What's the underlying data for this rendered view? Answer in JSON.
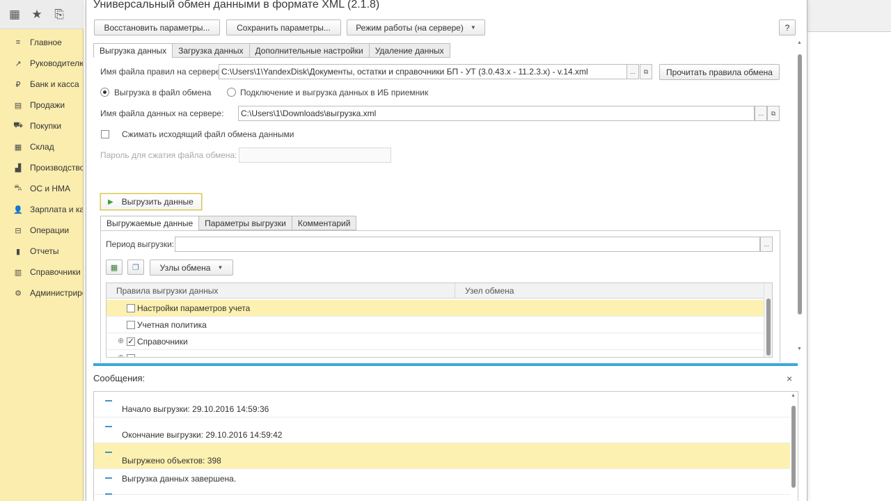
{
  "dialog": {
    "title": "Универсальный обмен данными в формате XML (2.1.8)",
    "help": "?"
  },
  "toolbar": {
    "restore": "Восстановить параметры...",
    "save": "Сохранить параметры...",
    "mode": "Режим работы (на сервере)"
  },
  "tabs": [
    "Выгрузка данных",
    "Загрузка данных",
    "Дополнительные настройки",
    "Удаление данных"
  ],
  "form": {
    "rules_file_label": "Имя файла правил на сервере:",
    "rules_file_value": "C:\\Users\\1\\YandexDisk\\Документы, остатки и справочники БП - УТ (3.0.43.x - 11.2.3.x) - v.14.xml",
    "read_rules": "Прочитать правила обмена",
    "radio_file": "Выгрузка в файл обмена",
    "radio_ib": "Подключение и выгрузка данных в ИБ приемник",
    "data_file_label": "Имя файла данных на сервере:",
    "data_file_value": "C:\\Users\\1\\Downloads\\выгрузка.xml",
    "compress_label": "Сжимать исходящий файл обмена данными",
    "password_label": "Пароль для сжатия файла обмена:",
    "dots": "...",
    "open": "⧉"
  },
  "run_button": "Выгрузить данные",
  "subtabs": [
    "Выгружаемые данные",
    "Параметры выгрузки",
    "Комментарий"
  ],
  "period_label": "Период выгрузки:",
  "nodes_button": "Узлы обмена",
  "grid": {
    "col1": "Правила выгрузки данных",
    "col2": "Узел обмена",
    "rows": [
      {
        "label": "Настройки параметров учета",
        "checked": false
      },
      {
        "label": "Учетная политика",
        "checked": false
      },
      {
        "label": "Справочники",
        "checked": true
      }
    ]
  },
  "messages": {
    "title": "Сообщения:",
    "close": "×",
    "items": [
      "Начало выгрузки: 29.10.2016 14:59:36",
      "Окончание выгрузки: 29.10.2016 14:59:42",
      "Выгружено объектов: 398",
      "Выгрузка данных завершена."
    ]
  },
  "sidebar": {
    "items": [
      {
        "icon": "≡",
        "label": "Главное"
      },
      {
        "icon": "↗",
        "label": "Руководителю"
      },
      {
        "icon": "₽",
        "label": "Банк и касса"
      },
      {
        "icon": "▤",
        "label": "Продажи"
      },
      {
        "icon": "⛟",
        "label": "Покупки"
      },
      {
        "icon": "▦",
        "label": "Склад"
      },
      {
        "icon": "▟",
        "label": "Производство"
      },
      {
        "icon": "⛍",
        "label": "ОС и НМА"
      },
      {
        "icon": "👤",
        "label": "Зарплата и кадры"
      },
      {
        "icon": "⊟",
        "label": "Операции"
      },
      {
        "icon": "▮",
        "label": "Отчеты"
      },
      {
        "icon": "▥",
        "label": "Справочники"
      },
      {
        "icon": "⚙",
        "label": "Администрирование"
      }
    ]
  },
  "colors": {
    "sidebar_bg": "#fbedae",
    "selected_row": "#fcf1b0",
    "accent_blue": "#39a9dc",
    "play_green": "#3aa23a"
  },
  "icons": {
    "apps": "▦",
    "favorites": "★",
    "history": "⎘"
  }
}
